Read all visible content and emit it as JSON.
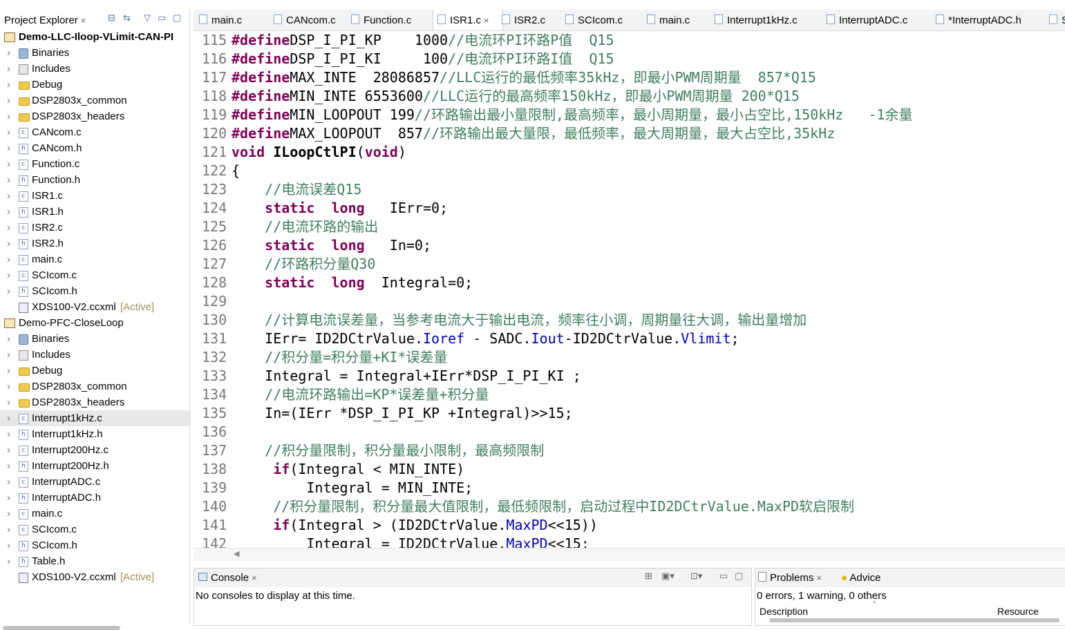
{
  "explorer": {
    "title": "Project Explorer",
    "close_glyph": "×",
    "projects": [
      {
        "name": "Demo-LLC-Iloop-VLimit-CAN-PI",
        "bold": true,
        "items": [
          {
            "label": "Binaries",
            "icon": "binaries-icon",
            "expandable": true
          },
          {
            "label": "Includes",
            "icon": "includes-icon",
            "expandable": true
          },
          {
            "label": "Debug",
            "icon": "folder-icon",
            "expandable": true
          },
          {
            "label": "DSP2803x_common",
            "icon": "folder-icon",
            "expandable": true
          },
          {
            "label": "DSP2803x_headers",
            "icon": "folder-icon",
            "expandable": true
          },
          {
            "label": "CANcom.c",
            "icon": "c-file-icon",
            "expandable": true
          },
          {
            "label": "CANcom.h",
            "icon": "h-file-icon",
            "expandable": true
          },
          {
            "label": "Function.c",
            "icon": "c-file-icon",
            "expandable": true
          },
          {
            "label": "Function.h",
            "icon": "h-file-icon",
            "expandable": true
          },
          {
            "label": "ISR1.c",
            "icon": "c-file-icon",
            "expandable": true
          },
          {
            "label": "ISR1.h",
            "icon": "h-file-icon",
            "expandable": true
          },
          {
            "label": "ISR2.c",
            "icon": "c-file-icon",
            "expandable": true
          },
          {
            "label": "ISR2.h",
            "icon": "h-file-icon",
            "expandable": true
          },
          {
            "label": "main.c",
            "icon": "c-file-icon",
            "expandable": true
          },
          {
            "label": "SCIcom.c",
            "icon": "c-file-icon",
            "expandable": true
          },
          {
            "label": "SCIcom.h",
            "icon": "h-file-icon",
            "expandable": true
          },
          {
            "label": "XDS100-V2.ccxml",
            "icon": "ccxml-icon",
            "expandable": false,
            "tag": "[Active]"
          }
        ]
      },
      {
        "name": "Demo-PFC-CloseLoop",
        "bold": false,
        "items": [
          {
            "label": "Binaries",
            "icon": "binaries-icon",
            "expandable": true
          },
          {
            "label": "Includes",
            "icon": "includes-icon",
            "expandable": true
          },
          {
            "label": "Debug",
            "icon": "folder-icon",
            "expandable": true
          },
          {
            "label": "DSP2803x_common",
            "icon": "folder-icon",
            "expandable": true
          },
          {
            "label": "DSP2803x_headers",
            "icon": "folder-icon",
            "expandable": true
          },
          {
            "label": "Interrupt1kHz.c",
            "icon": "c-file-icon",
            "expandable": true,
            "selected": true
          },
          {
            "label": "Interrupt1kHz.h",
            "icon": "h-file-icon",
            "expandable": true
          },
          {
            "label": "Interrupt200Hz.c",
            "icon": "c-file-icon",
            "expandable": true
          },
          {
            "label": "Interrupt200Hz.h",
            "icon": "h-file-icon",
            "expandable": true
          },
          {
            "label": "InterruptADC.c",
            "icon": "c-file-icon",
            "expandable": true
          },
          {
            "label": "InterruptADC.h",
            "icon": "h-file-icon",
            "expandable": true
          },
          {
            "label": "main.c",
            "icon": "c-file-icon",
            "expandable": true
          },
          {
            "label": "SCIcom.c",
            "icon": "c-file-icon",
            "expandable": true
          },
          {
            "label": "SCIcom.h",
            "icon": "h-file-icon",
            "expandable": true
          },
          {
            "label": "Table.h",
            "icon": "h-file-icon",
            "expandable": true
          },
          {
            "label": "XDS100-V2.ccxml",
            "icon": "ccxml-icon",
            "expandable": false,
            "tag": "[Active]"
          }
        ]
      }
    ]
  },
  "editor_tabs": [
    {
      "label": "main.c",
      "active": false
    },
    {
      "label": "CANcom.c",
      "active": false
    },
    {
      "label": "Function.c",
      "active": false
    },
    {
      "label": "ISR1.c",
      "active": true
    },
    {
      "label": "ISR2.c",
      "active": false
    },
    {
      "label": "SCIcom.c",
      "active": false
    },
    {
      "label": "main.c",
      "active": false
    },
    {
      "label": "Interrupt1kHz.c",
      "active": false
    },
    {
      "label": "InterruptADC.c",
      "active": false
    },
    {
      "label": "*InterruptADC.h",
      "active": false
    },
    {
      "label": "S",
      "active": false
    }
  ],
  "code_lines": [
    {
      "n": "115",
      "tokens": [
        [
          "kw",
          "#define"
        ],
        [
          "",
          "DSP_I_PI_KP    1000"
        ],
        [
          "cm",
          "//电流环PI环路P值  Q15"
        ]
      ]
    },
    {
      "n": "116",
      "tokens": [
        [
          "kw",
          "#define"
        ],
        [
          "",
          "DSP_I_PI_KI     100"
        ],
        [
          "cm",
          "//电流环PI环路I值  Q15"
        ]
      ]
    },
    {
      "n": "117",
      "tokens": [
        [
          "kw",
          "#define"
        ],
        [
          "",
          "MAX_INTE  28086857"
        ],
        [
          "cm",
          "//LLC运行的最低频率35kHz，即最小PWM周期量  857*Q15"
        ]
      ]
    },
    {
      "n": "118",
      "tokens": [
        [
          "kw",
          "#define"
        ],
        [
          "",
          "MIN_INTE 6553600"
        ],
        [
          "cm",
          "//LLC运行的最高频率150kHz，即最小PWM周期量 200*Q15"
        ]
      ]
    },
    {
      "n": "119",
      "tokens": [
        [
          "kw",
          "#define"
        ],
        [
          "",
          "MIN_LOOPOUT 199"
        ],
        [
          "cm",
          "//环路输出最小量限制,最高频率，最小周期量，最小占空比,150kHz   -1余量"
        ]
      ]
    },
    {
      "n": "120",
      "tokens": [
        [
          "kw",
          "#define"
        ],
        [
          "",
          "MAX_LOOPOUT  857"
        ],
        [
          "cm",
          "//环路输出最大量限，最低频率，最大周期量，最大占空比,35kHz"
        ]
      ]
    },
    {
      "n": "121",
      "tokens": [
        [
          "kw",
          "void"
        ],
        [
          "",
          " "
        ],
        [
          "b",
          "ILoopCtlPI"
        ],
        [
          "",
          "("
        ],
        [
          "kw",
          "void"
        ],
        [
          "",
          ")"
        ]
      ]
    },
    {
      "n": "122",
      "tokens": [
        [
          "",
          "{"
        ]
      ]
    },
    {
      "n": "123",
      "tokens": [
        [
          "",
          "    "
        ],
        [
          "cm",
          "//电流误差Q15"
        ]
      ]
    },
    {
      "n": "124",
      "tokens": [
        [
          "",
          "    "
        ],
        [
          "kw",
          "static"
        ],
        [
          "",
          "  "
        ],
        [
          "kw",
          "long"
        ],
        [
          "",
          "   IErr=0;"
        ]
      ]
    },
    {
      "n": "125",
      "tokens": [
        [
          "",
          "    "
        ],
        [
          "cm",
          "//电流环路的输出"
        ]
      ]
    },
    {
      "n": "126",
      "tokens": [
        [
          "",
          "    "
        ],
        [
          "kw",
          "static"
        ],
        [
          "",
          "  "
        ],
        [
          "kw",
          "long"
        ],
        [
          "",
          "   In=0;"
        ]
      ]
    },
    {
      "n": "127",
      "tokens": [
        [
          "",
          "    "
        ],
        [
          "cm",
          "//环路积分量Q30"
        ]
      ]
    },
    {
      "n": "128",
      "tokens": [
        [
          "",
          "    "
        ],
        [
          "kw",
          "static"
        ],
        [
          "",
          "  "
        ],
        [
          "kw",
          "long"
        ],
        [
          "",
          "  Integral=0;"
        ]
      ]
    },
    {
      "n": "129",
      "tokens": [
        [
          "",
          ""
        ]
      ]
    },
    {
      "n": "130",
      "tokens": [
        [
          "",
          "    "
        ],
        [
          "cm",
          "//计算电流误差量，当参考电流大于输出电流，频率往小调，周期量往大调，输出量增加"
        ]
      ]
    },
    {
      "n": "131",
      "tokens": [
        [
          "",
          "    IErr= ID2DCtrValue."
        ],
        [
          "fld",
          "Ioref"
        ],
        [
          "",
          " - SADC."
        ],
        [
          "fld",
          "Iout"
        ],
        [
          "",
          "-ID2DCtrValue."
        ],
        [
          "fld",
          "Vlimit"
        ],
        [
          "",
          ";"
        ]
      ]
    },
    {
      "n": "132",
      "tokens": [
        [
          "",
          "    "
        ],
        [
          "cm",
          "//积分量=积分量+KI*误差量"
        ]
      ]
    },
    {
      "n": "133",
      "tokens": [
        [
          "",
          "    Integral = Integral+IErr*DSP_I_PI_KI ;"
        ]
      ]
    },
    {
      "n": "134",
      "tokens": [
        [
          "",
          "    "
        ],
        [
          "cm",
          "//电流环路输出=KP*误差量+积分量"
        ]
      ]
    },
    {
      "n": "135",
      "tokens": [
        [
          "",
          "    In=(IErr *DSP_I_PI_KP +Integral)>>15;"
        ]
      ]
    },
    {
      "n": "136",
      "tokens": [
        [
          "",
          ""
        ]
      ]
    },
    {
      "n": "137",
      "tokens": [
        [
          "",
          "    "
        ],
        [
          "cm",
          "//积分量限制，积分量最小限制，最高频限制"
        ]
      ]
    },
    {
      "n": "138",
      "tokens": [
        [
          "",
          "     "
        ],
        [
          "kw",
          "if"
        ],
        [
          "",
          "(Integral < MIN_INTE)"
        ]
      ]
    },
    {
      "n": "139",
      "tokens": [
        [
          "",
          "         Integral = MIN_INTE;"
        ]
      ]
    },
    {
      "n": "140",
      "tokens": [
        [
          "",
          "     "
        ],
        [
          "cm",
          "//积分量限制，积分量最大值限制，最低频限制，启动过程中ID2DCtrValue.MaxPD软启限制"
        ]
      ]
    },
    {
      "n": "141",
      "tokens": [
        [
          "",
          "     "
        ],
        [
          "kw",
          "if"
        ],
        [
          "",
          "(Integral > (ID2DCtrValue."
        ],
        [
          "fld",
          "MaxPD"
        ],
        [
          "",
          "<<15))"
        ]
      ]
    },
    {
      "n": "142",
      "tokens": [
        [
          "",
          "         Integral = ID2DCtrValue."
        ],
        [
          "fld",
          "MaxPD"
        ],
        [
          "",
          "<<15;"
        ]
      ]
    }
  ],
  "console": {
    "title": "Console",
    "message": "No consoles to display at this time."
  },
  "problems": {
    "tab1": "Problems",
    "tab2": "Advice",
    "summary": "0 errors, 1 warning, 0 others",
    "col_description": "Description",
    "col_resource": "Resource"
  },
  "colors": {
    "keyword": "#7f0055",
    "comment": "#3f7f5f",
    "field": "#0000c0",
    "active_tag": "#a0925a"
  }
}
